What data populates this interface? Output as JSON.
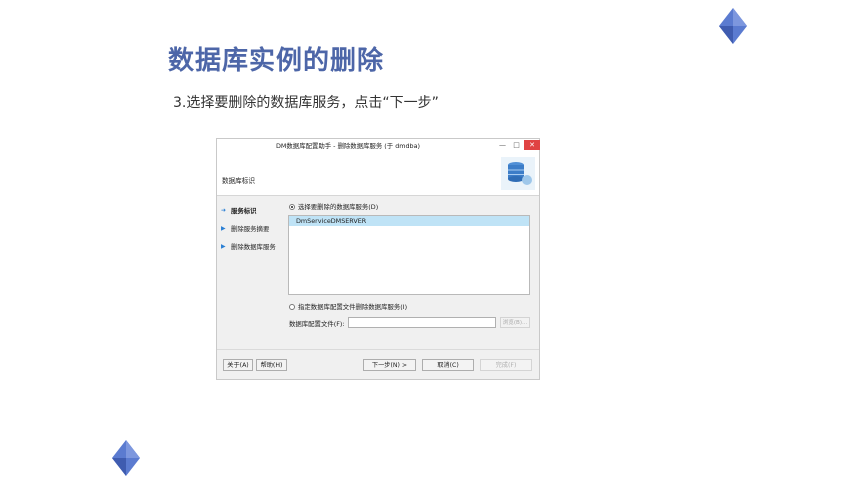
{
  "slide": {
    "title": "数据库实例的删除",
    "subtitle": "3.选择要删除的数据库服务，点击“下一步”",
    "accent_color": "#4d66a8"
  },
  "dialog": {
    "window_title": "DM数据库配置助手 - 删除数据库服务 (于 dmdba)",
    "controls": {
      "minimize": "—",
      "maximize": "□",
      "close": "✕"
    },
    "header_label": "数据库标识",
    "sidebar": [
      {
        "label": "服务标识",
        "active": true,
        "icon": "arrow-right-icon"
      },
      {
        "label": "删除服务摘要",
        "active": false,
        "icon": "triangle-right-icon"
      },
      {
        "label": "删除数据库服务",
        "active": false,
        "icon": "triangle-right-icon"
      }
    ],
    "option_select_label": "选择要删除的数据库服务(D)",
    "service_list": [
      "DmServiceDMSERVER"
    ],
    "option_config_label": "指定数据库配置文件删除数据库服务(I)",
    "config_file_label": "数据库配置文件(F):",
    "config_file_value": "",
    "browse_label": "浏览(B)...",
    "buttons": {
      "about": "关于(A)",
      "help": "帮助(H)",
      "next": "下一步(N) >",
      "cancel": "取消(C)",
      "finish": "完成(F)"
    }
  }
}
